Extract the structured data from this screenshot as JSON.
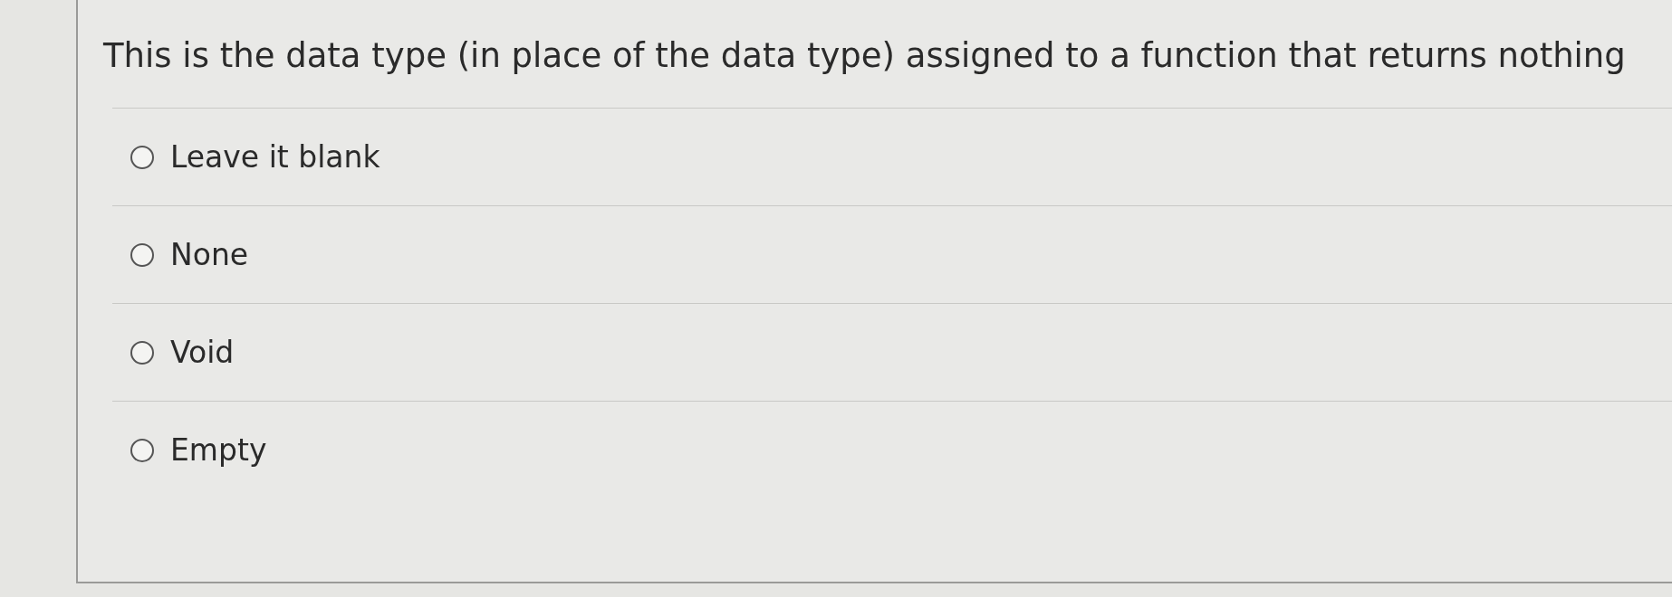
{
  "question": {
    "text": "This is the data type (in place of the data type) assigned to a function that returns nothing"
  },
  "options": [
    {
      "label": "Leave it blank",
      "selected": false
    },
    {
      "label": "None",
      "selected": false
    },
    {
      "label": "Void",
      "selected": false
    },
    {
      "label": "Empty",
      "selected": false
    }
  ]
}
